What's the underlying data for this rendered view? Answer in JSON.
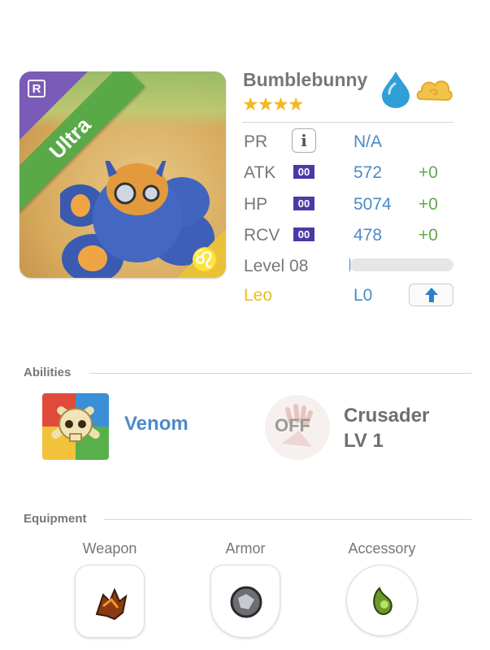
{
  "monster": {
    "name": "Bumblebunny",
    "stars": "★★★★",
    "rarity": "Ultra",
    "rank_badge": "R",
    "zodiac_glyph": "♌",
    "element_icons": [
      "water-drop-icon",
      "cloud-swirl-icon"
    ]
  },
  "stats": {
    "pr": {
      "label": "PR",
      "value": "N/A"
    },
    "atk": {
      "label": "ATK",
      "plus": "00",
      "value": "572",
      "bonus": "+0"
    },
    "hp": {
      "label": "HP",
      "plus": "00",
      "value": "5074",
      "bonus": "+0"
    },
    "rcv": {
      "label": "RCV",
      "plus": "00",
      "value": "478",
      "bonus": "+0"
    },
    "level": {
      "label": "Level 08",
      "progress": 0.01
    },
    "sign": {
      "label": "Leo",
      "value": "L0"
    }
  },
  "abilities": {
    "title": "Abilities",
    "active": {
      "name": "Venom"
    },
    "leader": {
      "status": "OFF",
      "name_line1": "Crusader",
      "name_line2": "LV 1"
    }
  },
  "equipment": {
    "title": "Equipment",
    "slots": [
      {
        "label": "Weapon"
      },
      {
        "label": "Armor"
      },
      {
        "label": "Accessory"
      }
    ]
  },
  "colors": {
    "ultra_green": "#5aa948",
    "corner_purple": "#7a5bb8",
    "leo_yellow": "#e8c020",
    "value_blue": "#4b8ac9",
    "bonus_green": "#5cab4d",
    "plus_purple": "#4a3aa8"
  }
}
